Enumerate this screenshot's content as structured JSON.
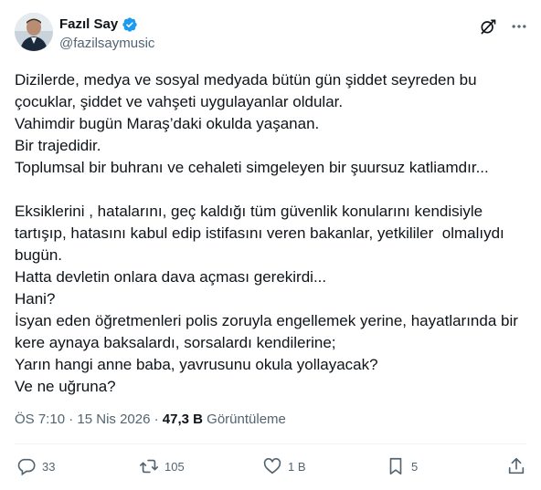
{
  "author": {
    "name": "Fazıl Say",
    "handle": "@fazilsaymusic",
    "verified": true
  },
  "icons": {
    "verified": "verified-badge-icon",
    "grok": "grok-icon",
    "more": "more-dots-icon",
    "reply": "reply-icon",
    "retweet": "retweet-icon",
    "like": "like-heart-icon",
    "bookmark": "bookmark-icon",
    "share": "share-icon"
  },
  "colors": {
    "verified_blue": "#1d9bf0",
    "text": "#0f1419",
    "secondary": "#536471"
  },
  "tweet": {
    "lines": [
      "Dizilerde, medya ve sosyal medyada bütün gün şiddet seyreden bu",
      "çocuklar, şiddet ve vahşeti uygulayanlar oldular.",
      "Vahimdir bugün Maraş’daki okulda yaşanan.",
      "Bir trajedidir.",
      "Toplumsal bir buhranı ve cehaleti simgeleyen bir şuursuz katliamdır...",
      "",
      "Eksiklerini , hatalarını, geç kaldığı tüm güvenlik konularını kendisiyle",
      "tartışıp, hatasını kabul edip istifasını veren bakanlar, yetkililer  olmalıydı",
      "bugün.",
      "Hatta devletin onlara dava açması gerekirdi...",
      "Hani?",
      "İsyan eden öğretmenleri polis zoruyla engellemek yerine, hayatlarında bir",
      "kere aynaya baksalardı, sorsalardı kendilerine;",
      "Yarın hangi anne baba, yavrusunu okula yollayacak?",
      "Ve ne uğruna?"
    ]
  },
  "meta": {
    "time": "ÖS 7:10",
    "separator": " · ",
    "date": "15 Nis 2026",
    "views_count": "47,3 B",
    "views_label": " Görüntüleme"
  },
  "actions": {
    "replies": "33",
    "retweets": "105",
    "likes": "1 B",
    "bookmarks": "5"
  }
}
